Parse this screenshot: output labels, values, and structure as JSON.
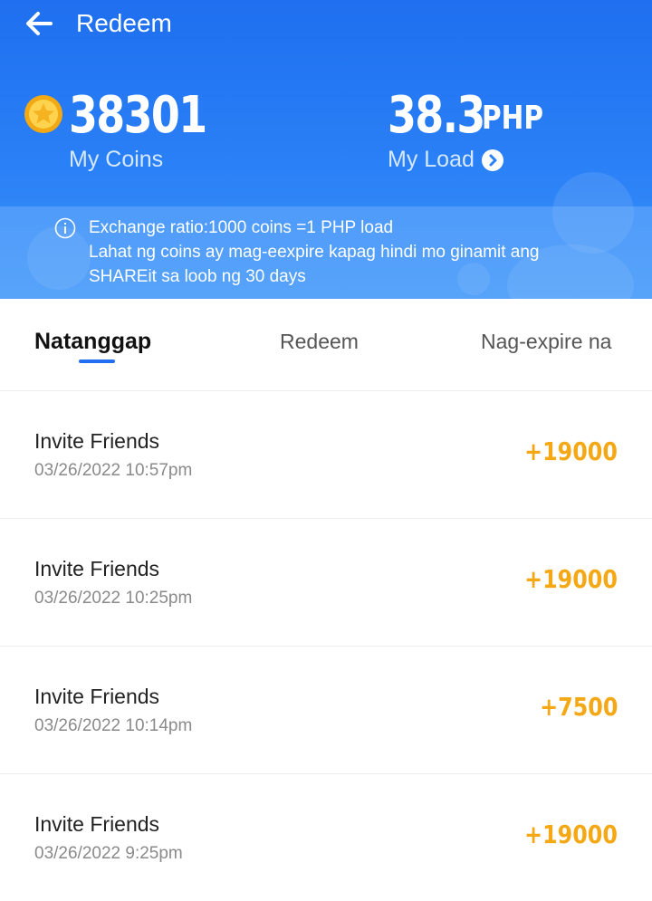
{
  "header": {
    "title": "Redeem",
    "coins": {
      "value": "38301",
      "label": "My Coins"
    },
    "load": {
      "value": "38.3",
      "currency": "PHP",
      "label": "My Load"
    },
    "notice": [
      "Exchange ratio:1000 coins =1 PHP load",
      "Lahat ng coins ay mag-eexpire kapag hindi mo ginamit ang",
      "SHAREit sa loob ng 30 days"
    ]
  },
  "tabs": [
    {
      "label": "Natanggap",
      "active": true
    },
    {
      "label": "Redeem",
      "active": false
    },
    {
      "label": "Nag-expire na",
      "active": false
    }
  ],
  "transactions": [
    {
      "title": "Invite Friends",
      "time": "03/26/2022 10:57pm",
      "amount": "+19000"
    },
    {
      "title": "Invite Friends",
      "time": "03/26/2022 10:25pm",
      "amount": "+19000"
    },
    {
      "title": "Invite Friends",
      "time": "03/26/2022 10:14pm",
      "amount": "+7500"
    },
    {
      "title": "Invite Friends",
      "time": "03/26/2022 9:25pm",
      "amount": "+19000"
    }
  ],
  "colors": {
    "header_blue": "#1f6ff0",
    "amount_orange": "#f5a815",
    "tab_indicator": "#1f6ff0"
  }
}
